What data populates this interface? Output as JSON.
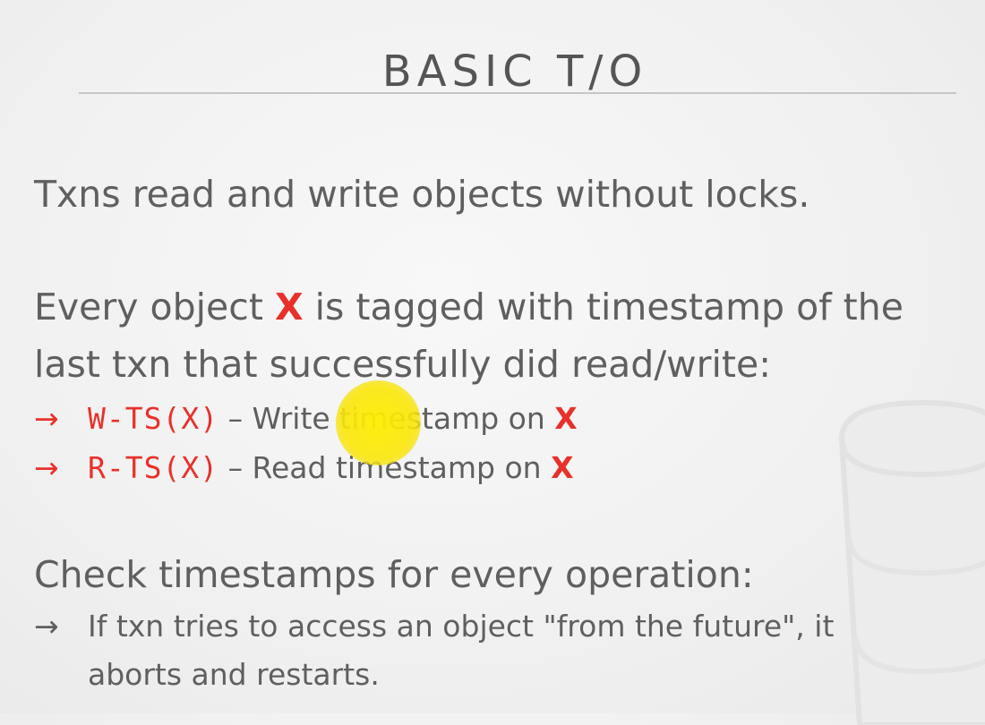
{
  "slide": {
    "title": "BASIC T/O",
    "paragraph1": "Txns read and write objects without locks.",
    "paragraph2": {
      "line1_before": "Every object ",
      "line1_var": "X",
      "line1_after": " is tagged with timestamp of the",
      "line2": "last txn that successfully did read/write:"
    },
    "bullets": [
      {
        "arrow": "→",
        "code": "W-TS(X)",
        "text": " – Write timestamp on ",
        "var": "X"
      },
      {
        "arrow": "→",
        "code": "R-TS(X)",
        "text": " – Read timestamp on ",
        "var": "X"
      }
    ],
    "paragraph3": "Check timestamps for every operation:",
    "sub_bullet": {
      "arrow": "→",
      "line1": "If txn tries to access an object \"from the future\", it",
      "line2": "aborts and restarts."
    }
  },
  "colors": {
    "accent": "#e8312a",
    "text": "#5f5f5f",
    "highlight": "#ffee00"
  },
  "icons": {
    "pointer": "pointer-highlight-icon",
    "background": "database-cylinder-icon"
  }
}
